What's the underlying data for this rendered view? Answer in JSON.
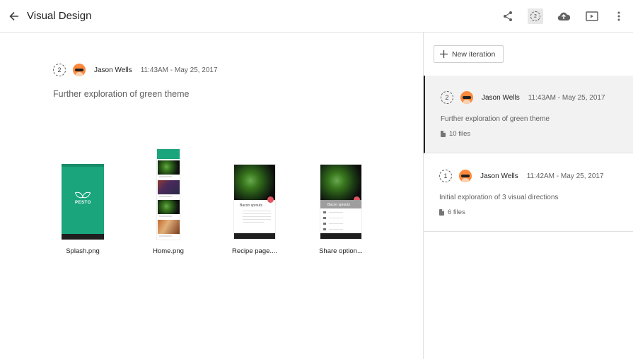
{
  "header": {
    "title": "Visual Design",
    "icons": [
      "back-arrow-icon",
      "share-icon",
      "iteration-history-icon",
      "upload-icon",
      "present-icon",
      "more-vert-icon"
    ],
    "iteration_badge": "2"
  },
  "main": {
    "iteration_number": "2",
    "author": "Jason Wells",
    "timestamp": "11:43AM - May 25, 2017",
    "description": "Further exploration of green theme",
    "files": [
      {
        "name": "Splash.png"
      },
      {
        "name": "Home.png"
      },
      {
        "name": "Recipe page...."
      },
      {
        "name": "Share option..."
      }
    ],
    "thumb_texts": {
      "pesto": "PESTO",
      "bacon": "Bacon sprouts"
    }
  },
  "sidebar": {
    "new_iteration_label": "New iteration",
    "iterations": [
      {
        "number": "2",
        "author": "Jason Wells",
        "timestamp": "11:43AM - May 25, 2017",
        "description": "Further exploration of green theme",
        "files": "10 files",
        "selected": true
      },
      {
        "number": "1",
        "author": "Jason Wells",
        "timestamp": "11:42AM - May 25, 2017",
        "description": "Initial exploration of 3 visual directions",
        "files": "6 files",
        "selected": false
      }
    ]
  },
  "colors": {
    "accent_green": "#1aa57c",
    "fab_red": "#e25563",
    "avatar_orange": "#ff8a3d"
  }
}
